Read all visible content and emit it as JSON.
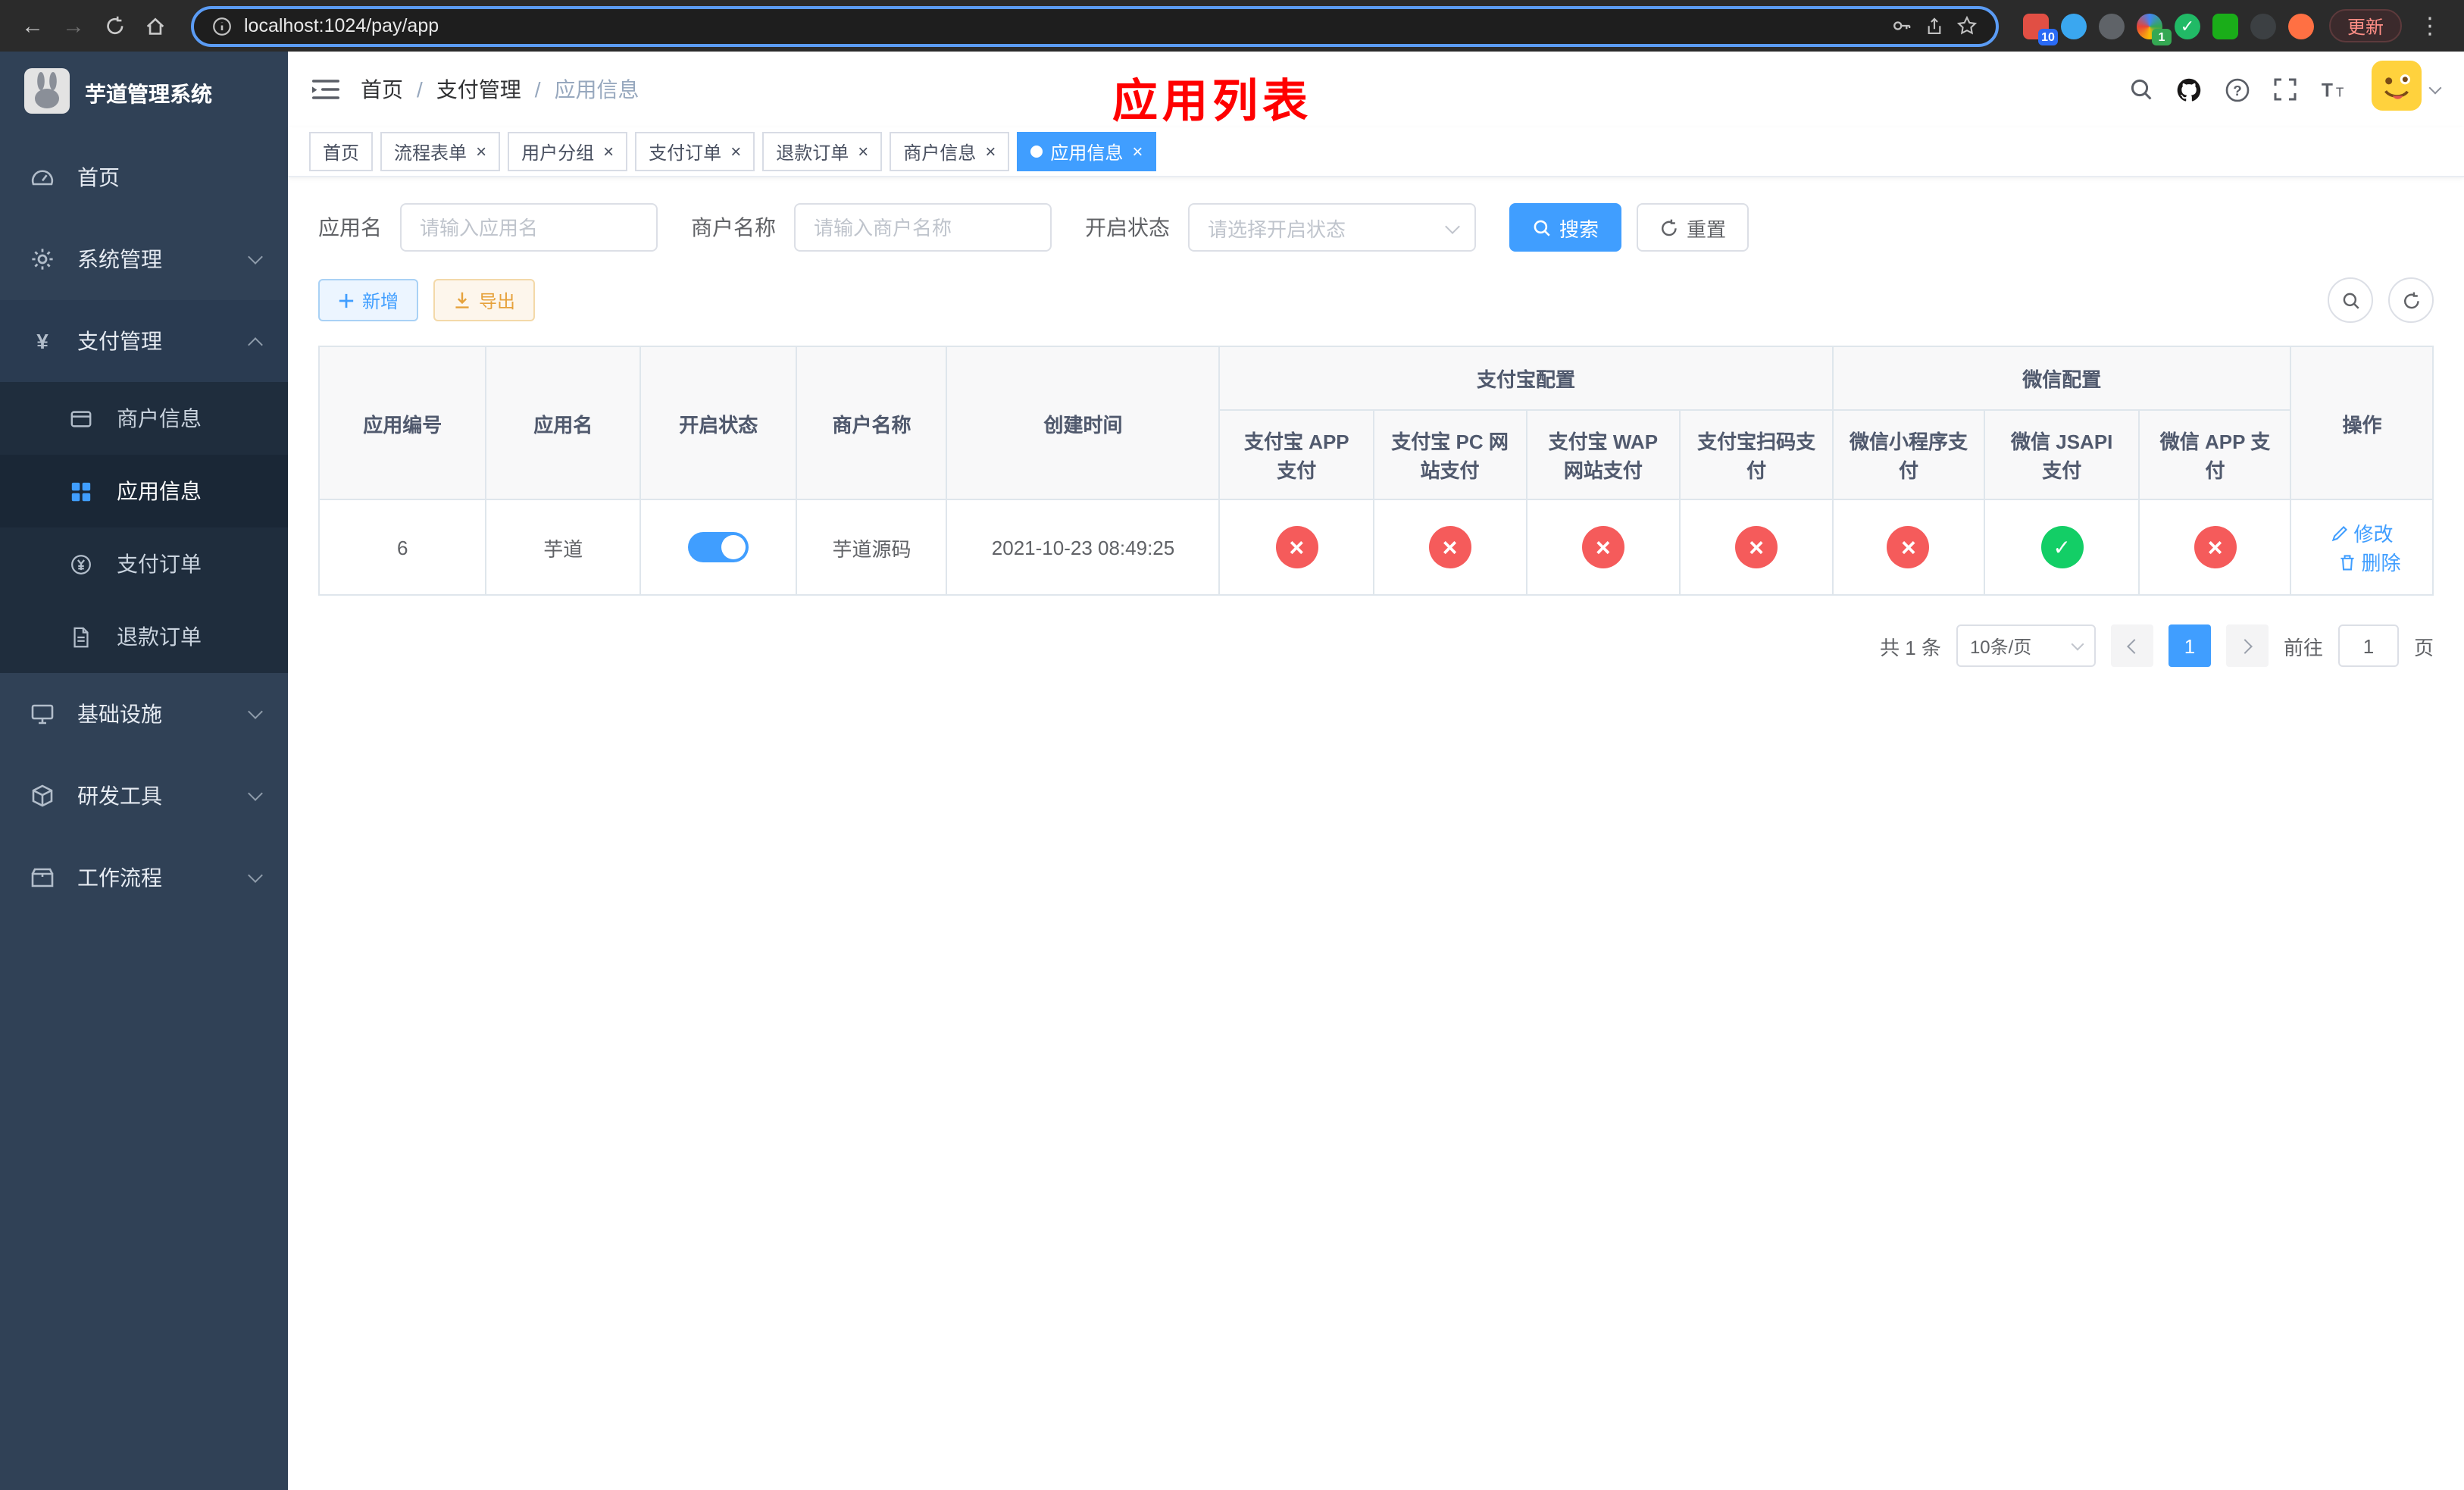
{
  "colors": {
    "accent": "#409eff",
    "danger": "#f55b5b",
    "success": "#13ce66",
    "warning": "#e6a23c",
    "sidebar_bg": "#304156",
    "submenu_bg": "#1f2d3d",
    "title_red": "#ff0000"
  },
  "browser": {
    "url": "localhost:1024/pay/app",
    "update_label": "更新",
    "ext_badge_1": "10",
    "ext_badge_2": "1"
  },
  "sidebar": {
    "app_title": "芋道管理系统",
    "items": [
      {
        "label": "首页"
      },
      {
        "label": "系统管理"
      },
      {
        "label": "支付管理"
      },
      {
        "label": "基础设施"
      },
      {
        "label": "研发工具"
      },
      {
        "label": "工作流程"
      }
    ],
    "payment_children": [
      {
        "label": "商户信息"
      },
      {
        "label": "应用信息"
      },
      {
        "label": "支付订单"
      },
      {
        "label": "退款订单"
      }
    ]
  },
  "header": {
    "breadcrumb": [
      "首页",
      "支付管理",
      "应用信息"
    ],
    "separator": "/",
    "page_title": "应用列表"
  },
  "tabs": [
    {
      "label": "首页"
    },
    {
      "label": "流程表单"
    },
    {
      "label": "用户分组"
    },
    {
      "label": "支付订单"
    },
    {
      "label": "退款订单"
    },
    {
      "label": "商户信息"
    },
    {
      "label": "应用信息"
    }
  ],
  "filters": {
    "app_name_label": "应用名",
    "app_name_placeholder": "请输入应用名",
    "merchant_label": "商户名称",
    "merchant_placeholder": "请输入商户名称",
    "status_label": "开启状态",
    "status_placeholder": "请选择开启状态",
    "search_label": "搜索",
    "reset_label": "重置"
  },
  "toolbar": {
    "add_label": "新增",
    "export_label": "导出"
  },
  "table": {
    "headers": {
      "app_id": "应用编号",
      "app_name": "应用名",
      "status": "开启状态",
      "merchant_name": "商户名称",
      "create_time": "创建时间",
      "alipay_group": "支付宝配置",
      "wechat_group": "微信配置",
      "alipay_app": "支付宝 APP 支付",
      "alipay_pc": "支付宝 PC 网站支付",
      "alipay_wap": "支付宝 WAP 网站支付",
      "alipay_qr": "支付宝扫码支付",
      "wechat_lite": "微信小程序支付",
      "wechat_jsapi": "微信 JSAPI 支付",
      "wechat_app": "微信 APP 支付",
      "actions": "操作"
    },
    "rows": [
      {
        "app_id": "6",
        "app_name": "芋道",
        "status_on": true,
        "merchant_name": "芋道源码",
        "create_time": "2021-10-23 08:49:25",
        "configs": [
          "no",
          "no",
          "no",
          "no",
          "no",
          "yes",
          "no"
        ],
        "edit_label": "修改",
        "delete_label": "删除"
      }
    ]
  },
  "pagination": {
    "total": "共 1 条",
    "page_size": "10条/页",
    "current_page": "1",
    "goto_label": "前往",
    "goto_value": "1",
    "unit_label": "页"
  }
}
